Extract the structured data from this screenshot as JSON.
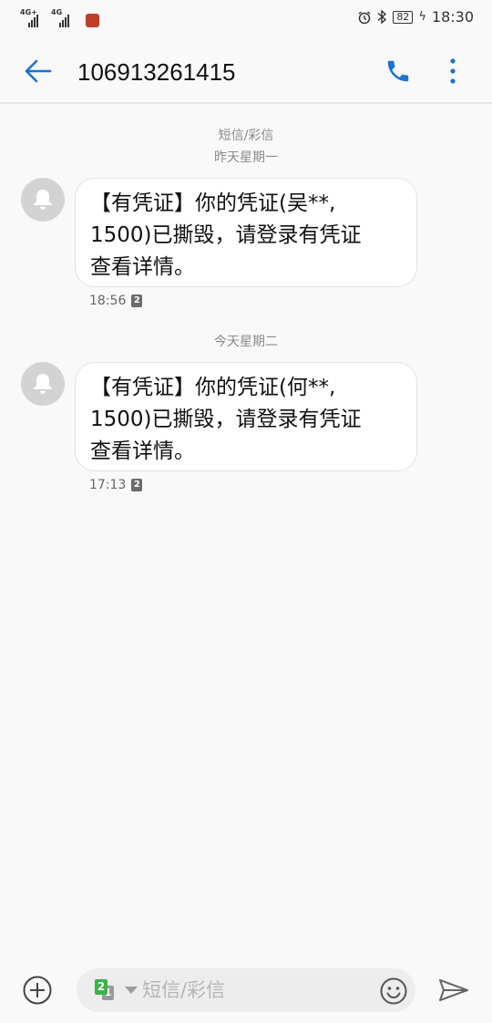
{
  "status_bar": {
    "signal1": "4G+",
    "signal2": "4G",
    "battery": "82",
    "time": "18:30"
  },
  "header": {
    "title": "106913261415",
    "back_icon": "arrow-left-icon",
    "call_icon": "phone-icon",
    "more_icon": "more-vert-icon"
  },
  "conversation": {
    "type_label": "短信/彩信",
    "groups": [
      {
        "date": "昨天星期一",
        "message": {
          "lines": [
            "【有凭证】你的凭证(吴**,",
            "1500)已撕毁，请登录有凭证",
            "查看详情。"
          ],
          "time": "18:56",
          "sim": "2"
        }
      },
      {
        "date": "今天星期二",
        "message": {
          "lines": [
            "【有凭证】你的凭证(何**,",
            "1500)已撕毁，请登录有凭证",
            "查看详情。"
          ],
          "time": "17:13",
          "sim": "2"
        }
      }
    ]
  },
  "composer": {
    "placeholder": "短信/彩信",
    "sim_active": "2",
    "sim_other": "1"
  },
  "colors": {
    "accent": "#1a73d6",
    "bubble_bg": "#ffffff",
    "background": "#f9f9f9"
  }
}
